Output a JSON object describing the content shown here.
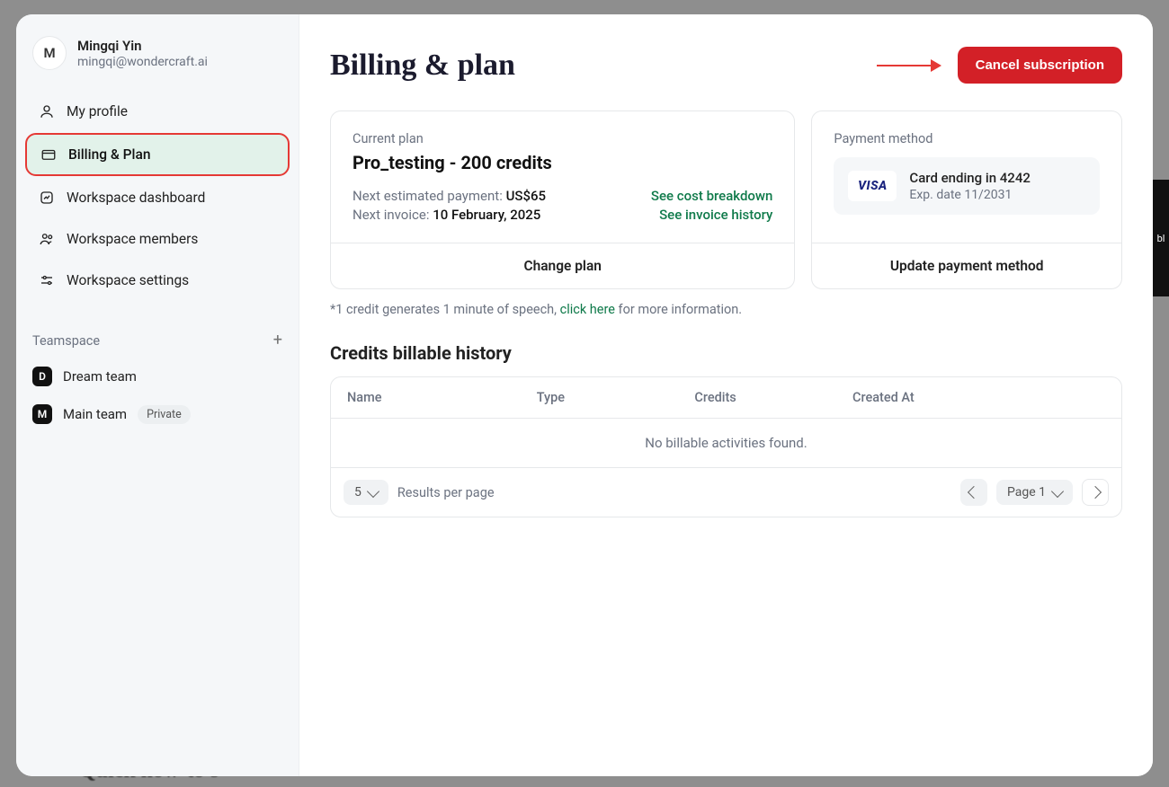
{
  "user": {
    "initial": "M",
    "name": "Mingqi Yin",
    "email": "mingqi@wondercraft.ai"
  },
  "sidebar": {
    "items": [
      {
        "label": "My profile"
      },
      {
        "label": "Billing & Plan"
      },
      {
        "label": "Workspace dashboard"
      },
      {
        "label": "Workspace members"
      },
      {
        "label": "Workspace settings"
      }
    ],
    "teamspace_header": "Teamspace",
    "teams": [
      {
        "initial": "D",
        "label": "Dream team",
        "private": false
      },
      {
        "initial": "M",
        "label": "Main team",
        "private": true
      }
    ],
    "private_badge": "Private"
  },
  "header": {
    "title": "Billing & plan",
    "cancel_button": "Cancel subscription"
  },
  "plan_card": {
    "label": "Current plan",
    "name": "Pro_testing - 200 credits",
    "next_payment_label": "Next estimated payment: ",
    "next_payment_value": "US$65",
    "cost_breakdown_link": "See cost breakdown",
    "next_invoice_label": "Next invoice: ",
    "next_invoice_value": "10 February, 2025",
    "invoice_history_link": "See invoice history",
    "change_plan": "Change plan"
  },
  "payment_card": {
    "label": "Payment method",
    "brand": "VISA",
    "ending": "Card ending in 4242",
    "exp": "Exp. date 11/2031",
    "update": "Update payment method"
  },
  "footnote": {
    "prefix": "*1 credit generates 1 minute of speech, ",
    "link": "click here",
    "suffix": " for more information."
  },
  "history": {
    "title": "Credits billable history",
    "columns": {
      "name": "Name",
      "type": "Type",
      "credits": "Credits",
      "created": "Created At"
    },
    "empty": "No billable activities found.",
    "per_page_value": "5",
    "per_page_label": "Results per page",
    "page_label": "Page 1"
  },
  "background": {
    "side_text": "bl",
    "bottom_text": "Quick how-to's"
  }
}
